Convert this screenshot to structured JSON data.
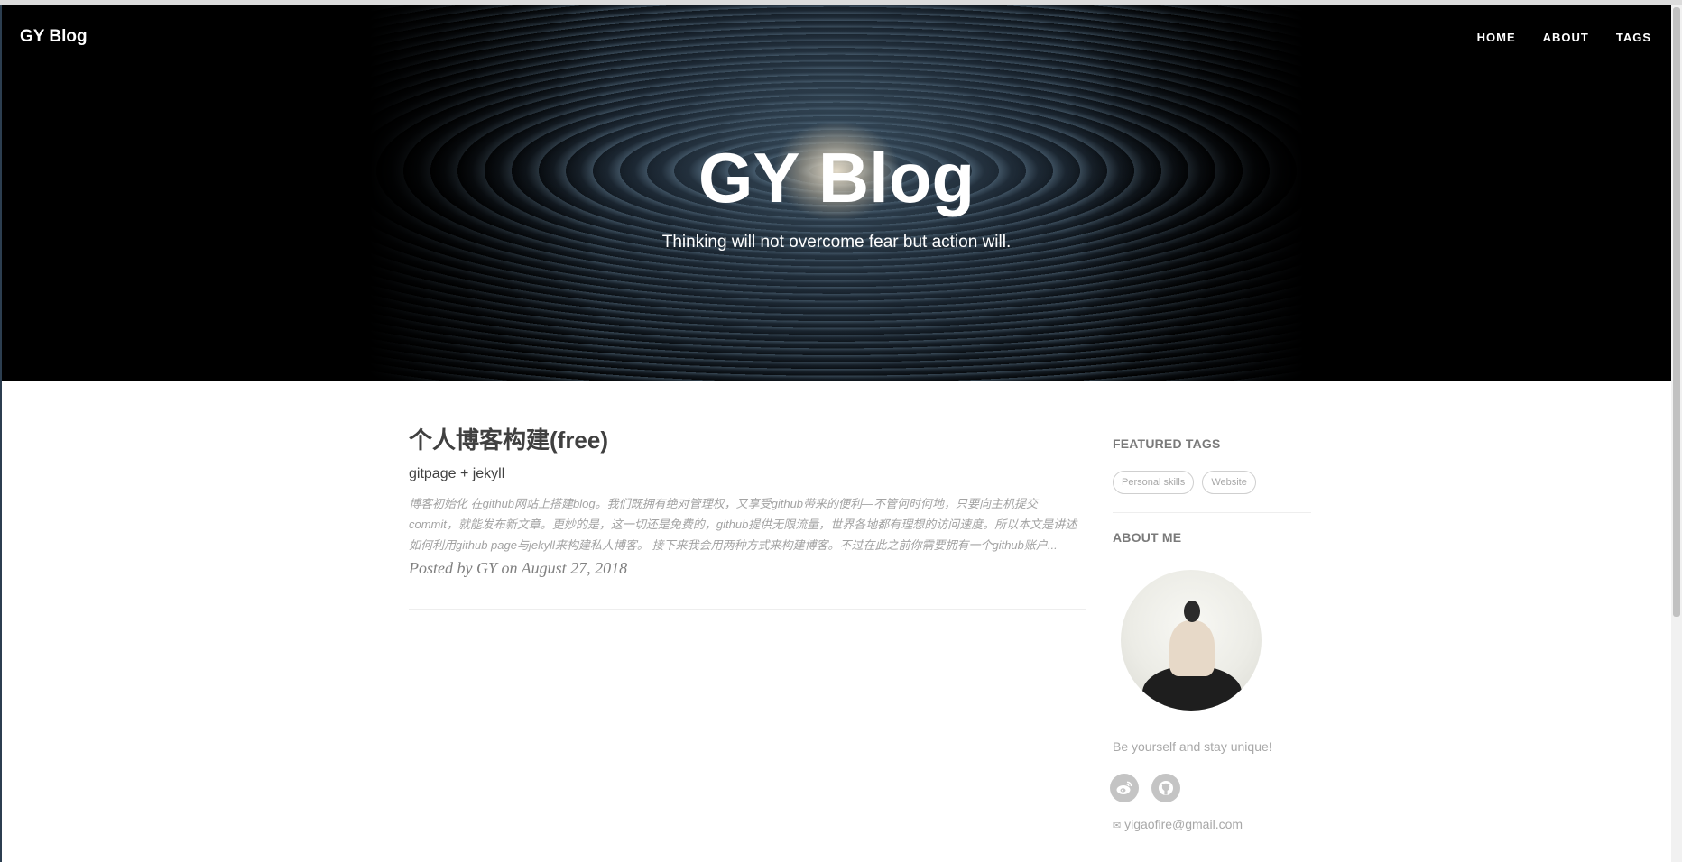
{
  "header": {
    "brand": "GY Blog",
    "nav": [
      "HOME",
      "ABOUT",
      "TAGS"
    ],
    "title": "GY Blog",
    "subtitle": "Thinking will not overcome fear but action will."
  },
  "post": {
    "title": "个人博客构建(free)",
    "subtitle": "gitpage + jekyll",
    "excerpt": "博客初始化 在github网站上搭建blog。我们既拥有绝对管理权，又享受github带来的便利—不管何时何地，只要向主机提交commit，就能发布新文章。更妙的是，这一切还是免费的，github提供无限流量，世界各地都有理想的访问速度。所以本文是讲述如何利用github page与jekyll来构建私人博客。 接下来我会用两种方式来构建博客。不过在此之前你需要拥有一个github账户...",
    "meta": "Posted by GY on August 27, 2018"
  },
  "sidebar": {
    "featured_tags_heading": "FEATURED TAGS",
    "tags": [
      "Personal skills",
      "Website"
    ],
    "about_heading": "ABOUT ME",
    "bio": "Be yourself and stay unique!",
    "socials": [
      "weibo-icon",
      "github-icon"
    ],
    "email_icon": "✉",
    "email": "yigaofire@gmail.com"
  }
}
